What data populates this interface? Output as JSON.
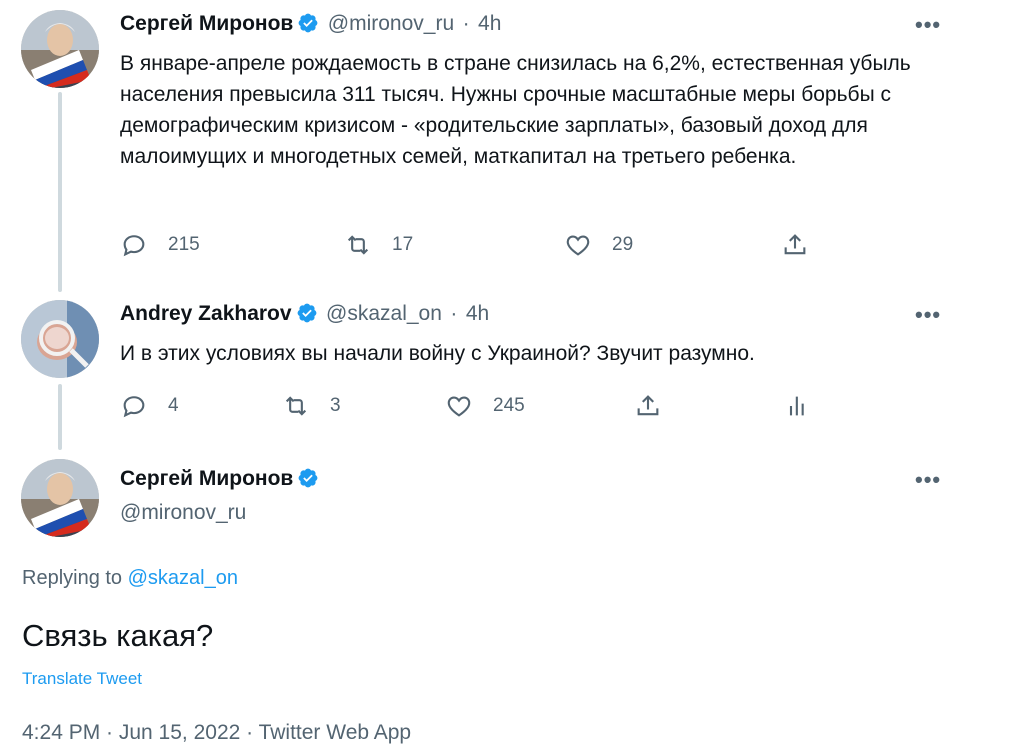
{
  "tweet1": {
    "name": "Сергей Миронов",
    "handle": "@mironov_ru",
    "time": "4h",
    "text": "В январе-апреле рождаемость в стране снизилась на 6,2%, естественная убыль населения превысила 311 тысяч. Нужны срочные масштабные меры борьбы с демографическим кризисом - «родительские зарплаты», базовый доход для малоимущих и многодетных семей, маткапитал на третьего ребенка.",
    "replies": "215",
    "retweets": "17",
    "likes": "29"
  },
  "tweet2": {
    "name": "Andrey Zakharov",
    "handle": "@skazal_on",
    "time": "4h",
    "text": "И в этих условиях вы начали войну с Украиной? Звучит разумно.",
    "replies": "4",
    "retweets": "3",
    "likes": "245"
  },
  "main_tweet": {
    "name": "Сергей Миронов",
    "handle": "@mironov_ru",
    "replying_prefix": "Replying to",
    "replying_to": "@skazal_on",
    "text": "Связь какая?",
    "translate": "Translate Tweet",
    "meta": "4:24 PM · Jun 15, 2022 · Twitter Web App"
  },
  "separator": "·",
  "more_glyph": "•••",
  "colors": {
    "accent": "#1d9bf0",
    "secondary_text": "#536471",
    "thread_line": "#cfd9de"
  }
}
